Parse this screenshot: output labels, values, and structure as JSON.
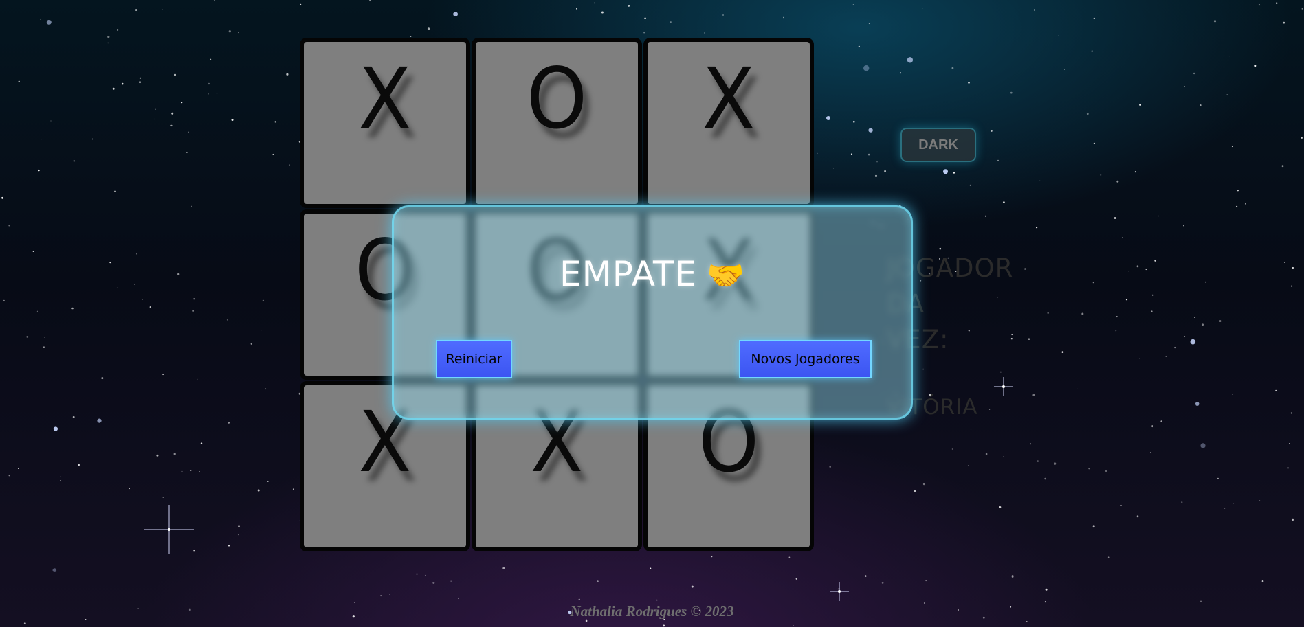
{
  "theme_toggle": {
    "label": "DARK"
  },
  "board": {
    "cells": [
      "X",
      "O",
      "X",
      "O",
      "O",
      "X",
      "X",
      "X",
      "O"
    ]
  },
  "side_panel": {
    "turn_label_lines": [
      "JOGADOR",
      "DA",
      "VEZ:"
    ],
    "victory_label": "VITÓRIA"
  },
  "modal": {
    "title": "EMPATE",
    "emoji": "🤝",
    "restart_label": "Reiniciar",
    "new_players_label": "Novos Jogadores"
  },
  "footer": {
    "text": "Nathalia Rodrigues © 2023"
  },
  "colors": {
    "cell_bg": "#7f7f7f",
    "modal_glow": "#50c8f0",
    "button_bg": "#4660fa"
  }
}
